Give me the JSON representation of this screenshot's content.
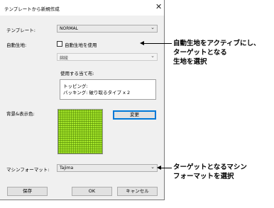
{
  "dialog": {
    "title": "テンプレートから新規作成",
    "close_glyph": "✕"
  },
  "template": {
    "label": "テンプレート:",
    "value": "NORMAL"
  },
  "auto_fabric": {
    "label": "自動生地:",
    "checkbox_label": "自動生地を使用",
    "checked": false,
    "fabric_value": "綿綾",
    "usage_label": "使用する当て布:",
    "usage_lines": [
      "トッピング:",
      "バッキング: 破り取るタイプ x 2"
    ]
  },
  "background": {
    "label": "背景&表示色:",
    "change_button": "変更",
    "swatch_color": "#a6e82a"
  },
  "machine_format": {
    "label": "マシンフォーマット:",
    "value": "Tajima"
  },
  "footer": {
    "save_button": "保存",
    "ok_button": "OK",
    "cancel_button": "キャンセル"
  },
  "annotations": {
    "fabric_note": [
      "自動生地をアクティブにし、",
      "ターゲットとなる",
      "生地を選択"
    ],
    "machine_note": [
      "ターゲットとなるマシン",
      "フォーマットを選択"
    ]
  },
  "icons": {
    "chevron": "⌄"
  }
}
